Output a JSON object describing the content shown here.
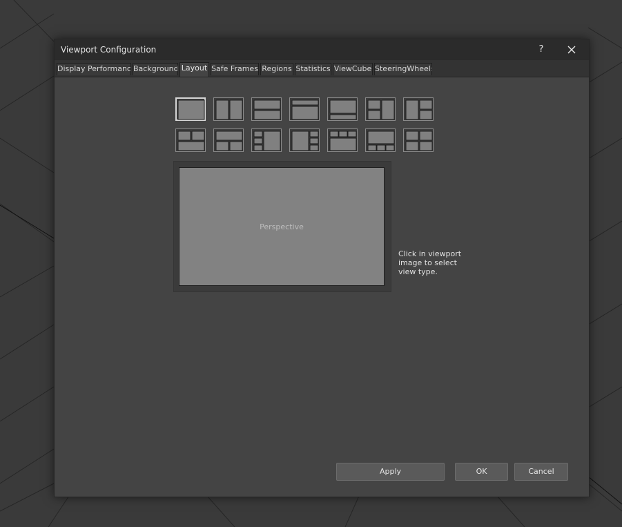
{
  "dialog": {
    "title": "Viewport Configuration",
    "help_label": "?",
    "close_icon": "close-icon"
  },
  "tabs": [
    {
      "label": "Display Performance",
      "active": false
    },
    {
      "label": "Background",
      "active": false
    },
    {
      "label": "Layout",
      "active": true
    },
    {
      "label": "Safe Frames",
      "active": false
    },
    {
      "label": "Regions",
      "active": false
    },
    {
      "label": "Statistics",
      "active": false
    },
    {
      "label": "ViewCube",
      "active": false
    },
    {
      "label": "SteeringWheels",
      "active": false
    }
  ],
  "layouts": {
    "selected_index": 0,
    "count": 14
  },
  "preview": {
    "viewport_label": "Perspective",
    "hint": "Click in viewport image to select view type."
  },
  "buttons": {
    "apply": "Apply",
    "ok": "OK",
    "cancel": "Cancel"
  }
}
